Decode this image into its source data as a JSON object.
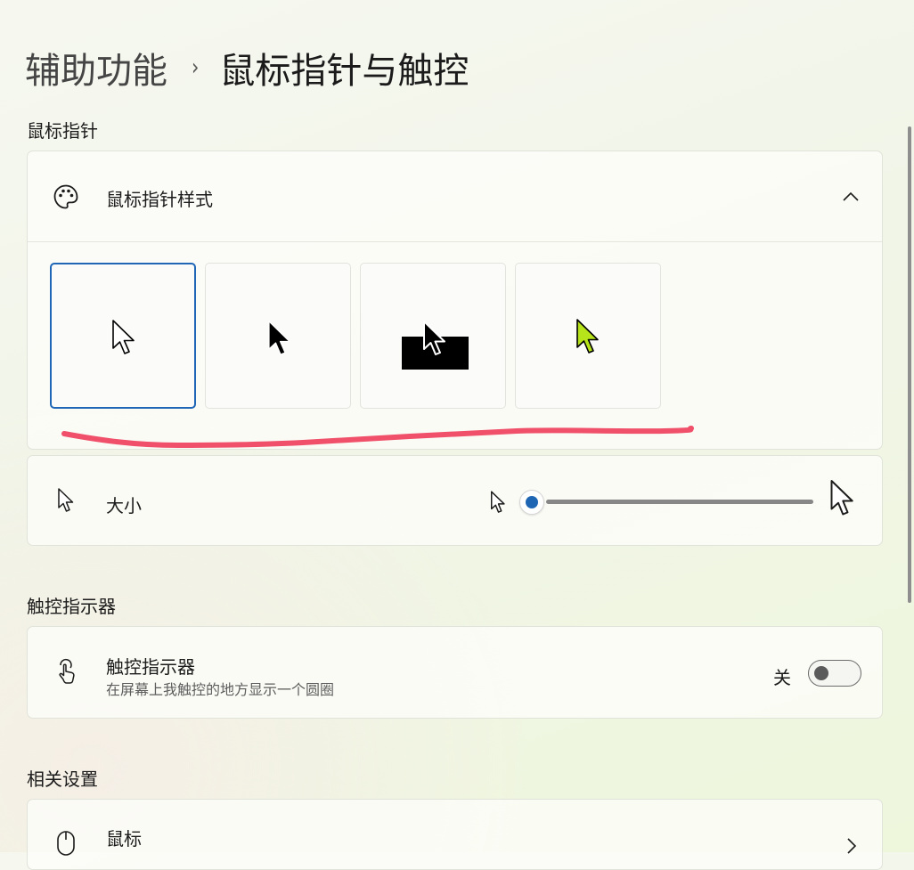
{
  "breadcrumb": {
    "parent": "辅助功能",
    "separator": "›",
    "current": "鼠标指针与触控"
  },
  "sections": {
    "pointer": "鼠标指针",
    "touch": "触控指示器",
    "related": "相关设置"
  },
  "pointer_style": {
    "label": "鼠标指针样式",
    "icon": "palette-icon",
    "expanded": true,
    "selected_index": 0,
    "options": [
      {
        "name": "white-pointer",
        "fill": "#ffffff",
        "stroke": "#000000"
      },
      {
        "name": "black-pointer",
        "fill": "#000000",
        "stroke": "#ffffff"
      },
      {
        "name": "inverted-pointer",
        "fill": "#000000",
        "stroke": "#ffffff"
      },
      {
        "name": "custom-color-pointer",
        "fill": "#b6e31a",
        "stroke": "#000000"
      }
    ]
  },
  "size": {
    "label": "大小",
    "icon": "pointer-icon",
    "value": 1,
    "min": 1,
    "max": 15
  },
  "touch_indicator": {
    "label": "触控指示器",
    "description": "在屏幕上我触控的地方显示一个圆圈",
    "icon": "touch-hand-icon",
    "state_label": "关",
    "on": false
  },
  "mouse": {
    "label": "鼠标",
    "icon": "mouse-icon"
  },
  "colors": {
    "accent": "#1e66b4",
    "annotation": "#f0506a"
  }
}
